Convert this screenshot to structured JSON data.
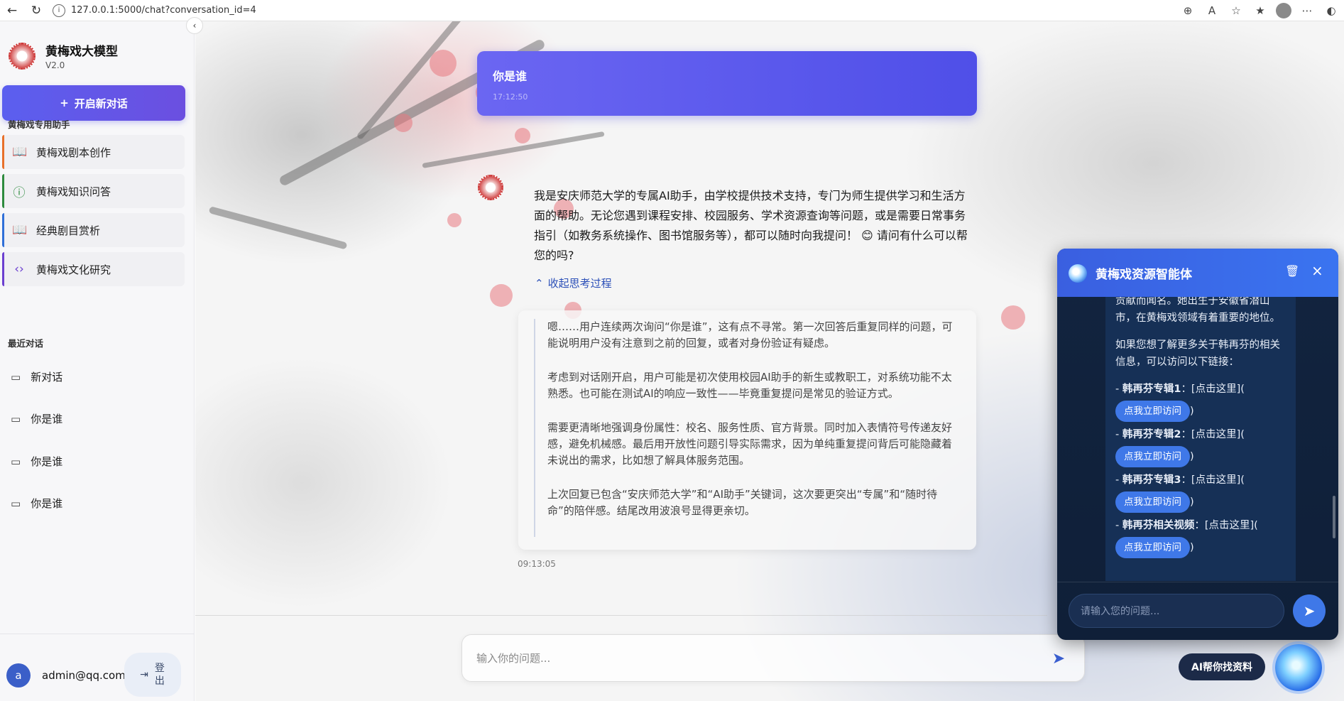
{
  "browser": {
    "url": "127.0.0.1:5000/chat?conversation_id=4"
  },
  "sidebar": {
    "brand_title": "黄梅戏大模型",
    "brand_version": "V2.0",
    "new_chat_label": "开启新对话",
    "assistants_title": "黄梅戏专用助手",
    "assistants": [
      {
        "label": "黄梅戏剧本创作",
        "icon": "book-open-icon",
        "color": "#e8702a"
      },
      {
        "label": "黄梅戏知识问答",
        "icon": "info-circle-icon",
        "color": "#2e8b3e"
      },
      {
        "label": "经典剧目赏析",
        "icon": "book-open-icon",
        "color": "#2f6fd8"
      },
      {
        "label": "黄梅戏文化研究",
        "icon": "code-icon",
        "color": "#6b3fd0"
      }
    ],
    "recent_title": "最近对话",
    "recent": [
      {
        "label": "新对话"
      },
      {
        "label": "你是谁"
      },
      {
        "label": "你是谁"
      },
      {
        "label": "你是谁"
      }
    ],
    "user": {
      "avatar_letter": "a",
      "email": "admin@qq.com",
      "logout_label": "登出"
    }
  },
  "chat": {
    "user_message": "你是谁",
    "user_time": "17:12:50",
    "bot_message": "我是安庆师范大学的专属AI助手，由学校提供技术支持，专门为师生提供学习和生活方面的帮助。无论您遇到课程安排、校园服务、学术资源查询等问题，或是需要日常事务指引（如教务系统操作、图书馆服务等），都可以随时向我提问！ 😊 请问有什么可以帮您的吗?",
    "think_toggle_label": "收起思考过程",
    "think_paragraphs": [
      "嗯……用户连续两次询问“你是谁”，这有点不寻常。第一次回答后重复同样的问题，可能说明用户没有注意到之前的回复，或者对身份验证有疑虑。",
      "考虑到对话刚开启，用户可能是初次使用校园AI助手的新生或教职工，对系统功能不太熟悉。也可能在测试AI的响应一致性——毕竟重复提问是常见的验证方式。",
      "需要更清晰地强调身份属性：校名、服务性质、官方背景。同时加入表情符号传递友好感，避免机械感。最后用开放性问题引导实际需求，因为单纯重复提问背后可能隐藏着未说出的需求，比如想了解具体服务范围。",
      "上次回复已包含“安庆师范大学”和“AI助手”关键词，这次要更突出“专属”和“随时待命”的陪伴感。结尾改用波浪号显得更亲切。"
    ],
    "bot_time": "09:13:05",
    "input_placeholder": "输入你的问题..."
  },
  "agent_panel": {
    "title": "黄梅戏资源智能体",
    "intro_lines": "贡献而闻名。她出生于安徽省潜山市，在黄梅戏领域有着重要的地位。",
    "more_info": "如果您想了解更多关于韩再芬的相关信息，可以访问以下链接：",
    "links": [
      {
        "name": "韩再芬专辑1",
        "text": "：[点击这里](",
        "button": "点我立即访问",
        "close": ")"
      },
      {
        "name": "韩再芬专辑2",
        "text": "：[点击这里](",
        "button": "点我立即访问",
        "close": ")"
      },
      {
        "name": "韩再芬专辑3",
        "text": "：[点击这里](",
        "button": "点我立即访问",
        "close": ")"
      },
      {
        "name": "韩再芬相关视频",
        "text": "：[点击这里](",
        "button": "点我立即访问",
        "close": ")"
      }
    ],
    "input_placeholder": "请输入您的问题...",
    "fab_label": "AI帮你找资料"
  }
}
